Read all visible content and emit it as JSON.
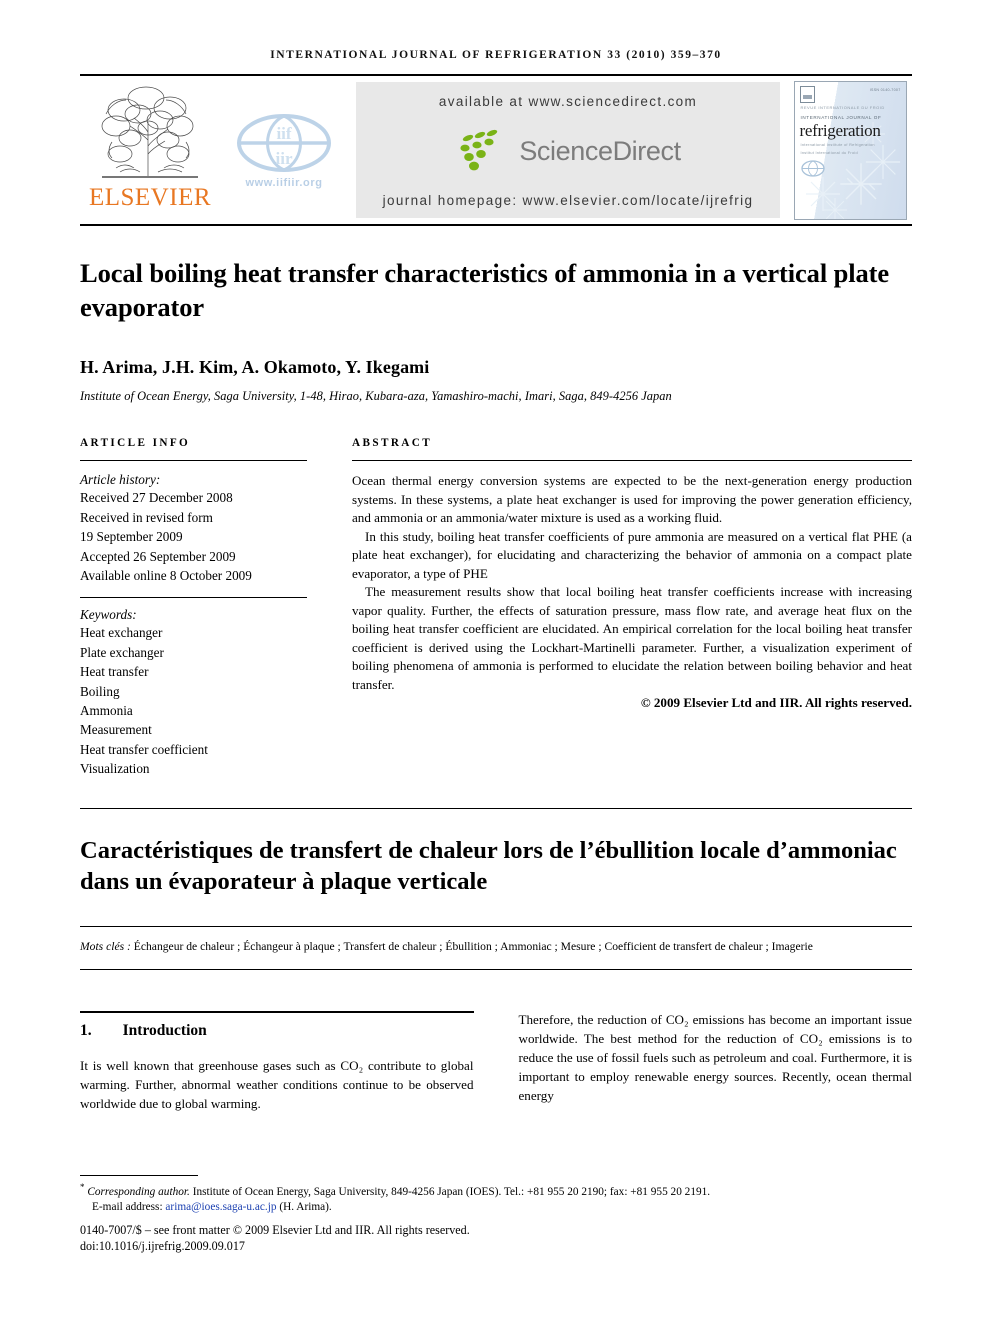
{
  "running_head": "International Journal of Refrigeration 33 (2010) 359–370",
  "masthead": {
    "publisher_name": "ELSEVIER",
    "iir_url": "www.iifiir.org",
    "iir_globe_top": "iif",
    "iir_globe_bottom": "iir",
    "available_at": "available at www.sciencedirect.com",
    "sciencedirect_label": "ScienceDirect",
    "journal_homepage": "journal homepage: www.elsevier.com/locate/ijrefrig",
    "cover": {
      "line_top": "REVUE INTERNATIONALE DU FROID",
      "line_small": "INTERNATIONAL JOURNAL OF",
      "title": "refrigeration",
      "sub1": "International Institute of Refrigeration",
      "sub2": "Institut International du Froid",
      "code": "ISSN 0140-7007"
    }
  },
  "article": {
    "title": "Local boiling heat transfer characteristics of ammonia in a vertical plate evaporator",
    "authors": "H. Arima, J.H. Kim, A. Okamoto, Y. Ikegami",
    "corresponding_marker": "*",
    "affiliation": "Institute of Ocean Energy, Saga University, 1-48, Hirao, Kubara-aza, Yamashiro-machi, Imari, Saga, 849-4256 Japan"
  },
  "article_info": {
    "heading": "ARTICLE INFO",
    "history_label": "Article history:",
    "history": [
      "Received 27 December 2008",
      "Received in revised form",
      "19 September 2009",
      "Accepted 26 September 2009",
      "Available online 8 October 2009"
    ],
    "keywords_label": "Keywords:",
    "keywords": [
      "Heat exchanger",
      "Plate exchanger",
      "Heat transfer",
      "Boiling",
      "Ammonia",
      "Measurement",
      "Heat transfer coefficient",
      "Visualization"
    ]
  },
  "abstract": {
    "heading": "ABSTRACT",
    "paragraphs": [
      "Ocean thermal energy conversion systems are expected to be the next-generation energy production systems. In these systems, a plate heat exchanger is used for improving the power generation efficiency, and ammonia or an ammonia/water mixture is used as a working fluid.",
      "In this study, boiling heat transfer coefficients of pure ammonia are measured on a vertical flat PHE (a plate heat exchanger), for elucidating and characterizing the behavior of ammonia on a compact plate evaporator, a type of PHE",
      "The measurement results show that local boiling heat transfer coefficients increase with increasing vapor quality. Further, the effects of saturation pressure, mass flow rate, and average heat flux on the boiling heat transfer coefficient are elucidated. An empirical correlation for the local boiling heat transfer coefficient is derived using the Lockhart-Martinelli parameter. Further, a visualization experiment of boiling phenomena of ammonia is performed to elucidate the relation between boiling behavior and heat transfer."
    ],
    "copyright": "© 2009 Elsevier Ltd and IIR. All rights reserved."
  },
  "french": {
    "title": "Caractéristiques de transfert de chaleur lors de l’ébullition locale d’ammoniac dans un évaporateur à plaque verticale",
    "keywords_label": "Mots clés :",
    "keywords": "Échangeur de chaleur ; Échangeur à plaque ; Transfert de chaleur ; Ébullition ; Ammoniac ; Mesure ; Coefficient de transfert de chaleur ; Imagerie"
  },
  "body": {
    "section_number": "1.",
    "section_title": "Introduction",
    "left_paragraph": "It is well known that greenhouse gases such as CO₂ contribute to global warming. Further, abnormal weather conditions continue to be observed worldwide due to global warming.",
    "right_paragraph": "Therefore, the reduction of CO₂ emissions has become an important issue worldwide. The best method for the reduction of CO₂ emissions is to reduce the use of fossil fuels such as petroleum and coal. Furthermore, it is important to employ renewable energy sources. Recently, ocean thermal energy"
  },
  "footnotes": {
    "corresponding_marker": "*",
    "corresponding_label": "Corresponding author.",
    "corresponding_rest": "Institute of Ocean Energy, Saga University, 849-4256 Japan (IOES). Tel.: +81 955 20 2190; fax: +81 955 20 2191.",
    "email_label": "E-mail address:",
    "email": "arima@ioes.saga-u.ac.jp",
    "email_suffix": "(H. Arima).",
    "front_matter": "0140-7007/$ – see front matter © 2009 Elsevier Ltd and IIR. All rights reserved.",
    "doi": "doi:10.1016/j.ijrefrig.2009.09.017"
  },
  "colors": {
    "elsevier_orange": "#E87722",
    "link_blue": "#1a3fb0",
    "sd_green": "#7AB317",
    "banner_gray": "#e8e8e8"
  }
}
